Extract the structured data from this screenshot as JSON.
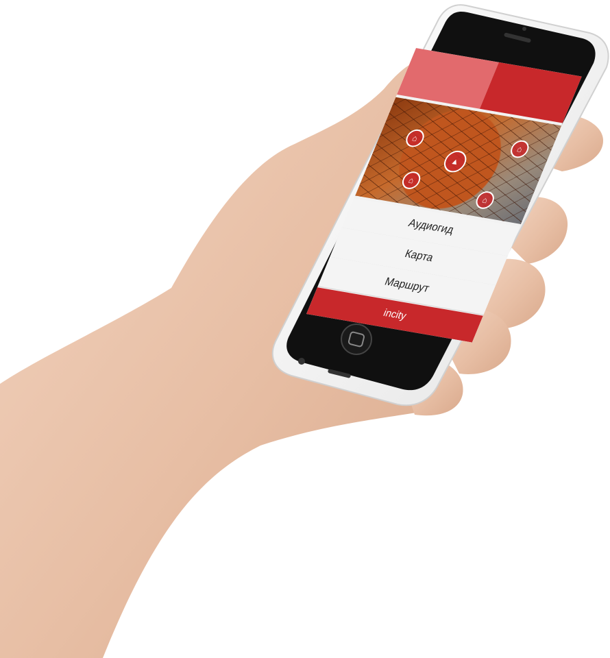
{
  "colors": {
    "accent": "#c8282b",
    "accent_light": "#e26a6d",
    "menu_bg": "#f4f4f4",
    "phone_body": "#f4f4f4",
    "skin": "#e8c1a8"
  },
  "app": {
    "menu": [
      {
        "label": "Аудиогид",
        "icon": "headphones-icon"
      },
      {
        "label": "Карта",
        "icon": "map-icon"
      },
      {
        "label": "Маршрут",
        "icon": "route-icon"
      }
    ],
    "brand": "incity",
    "map_pins": [
      "landmark-pin-icon",
      "landmark-pin-icon",
      "location-arrow-icon",
      "landmark-pin-icon",
      "landmark-pin-icon"
    ]
  }
}
